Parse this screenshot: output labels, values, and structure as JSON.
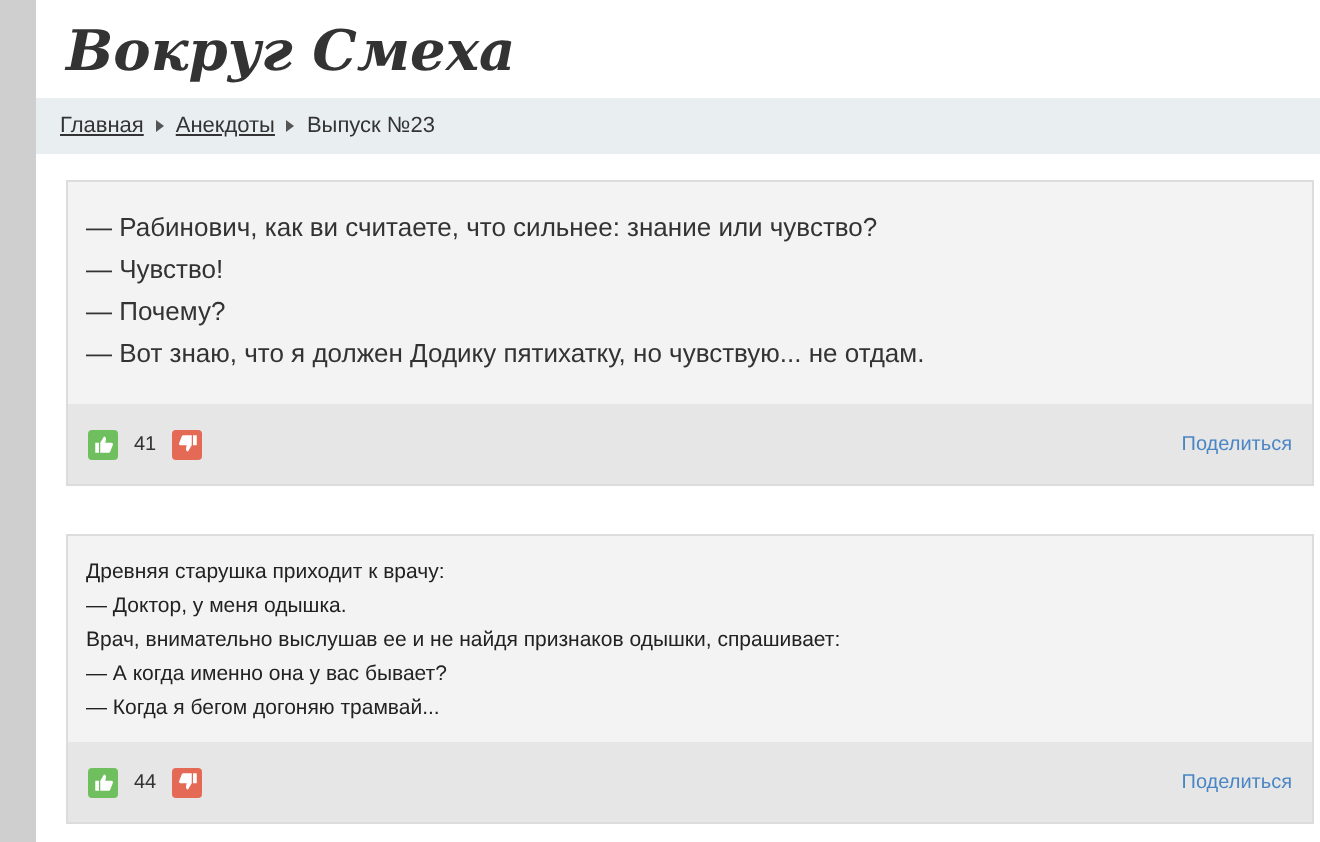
{
  "site_title": "Вокруг Смеха",
  "breadcrumbs": [
    {
      "label": "Главная",
      "kind": "link"
    },
    {
      "label": "Анекдоты",
      "kind": "link"
    },
    {
      "label": "Выпуск №23",
      "kind": "current"
    }
  ],
  "jokes": [
    {
      "kind": "large",
      "lines": [
        "— Рабинович, как ви считаете, что сильнее: знание или чувство?",
        "— Чувство!",
        "— Почему?",
        "— Вот знаю, что я должен Додику пятихатку, но чувствую... не отдам."
      ],
      "votes": "41",
      "share": "Поделиться"
    },
    {
      "kind": "small",
      "lines": [
        "Древняя старушка приходит к врачу:",
        "— Доктор, у меня одышка.",
        "Врач, внимательно выслушав ее и не найдя признаков одышки, спрашивает:",
        "— А когда именно она у вас бывает?",
        "— Когда я бегом догоняю трамвай..."
      ],
      "votes": "44",
      "share": "Поделиться"
    }
  ]
}
